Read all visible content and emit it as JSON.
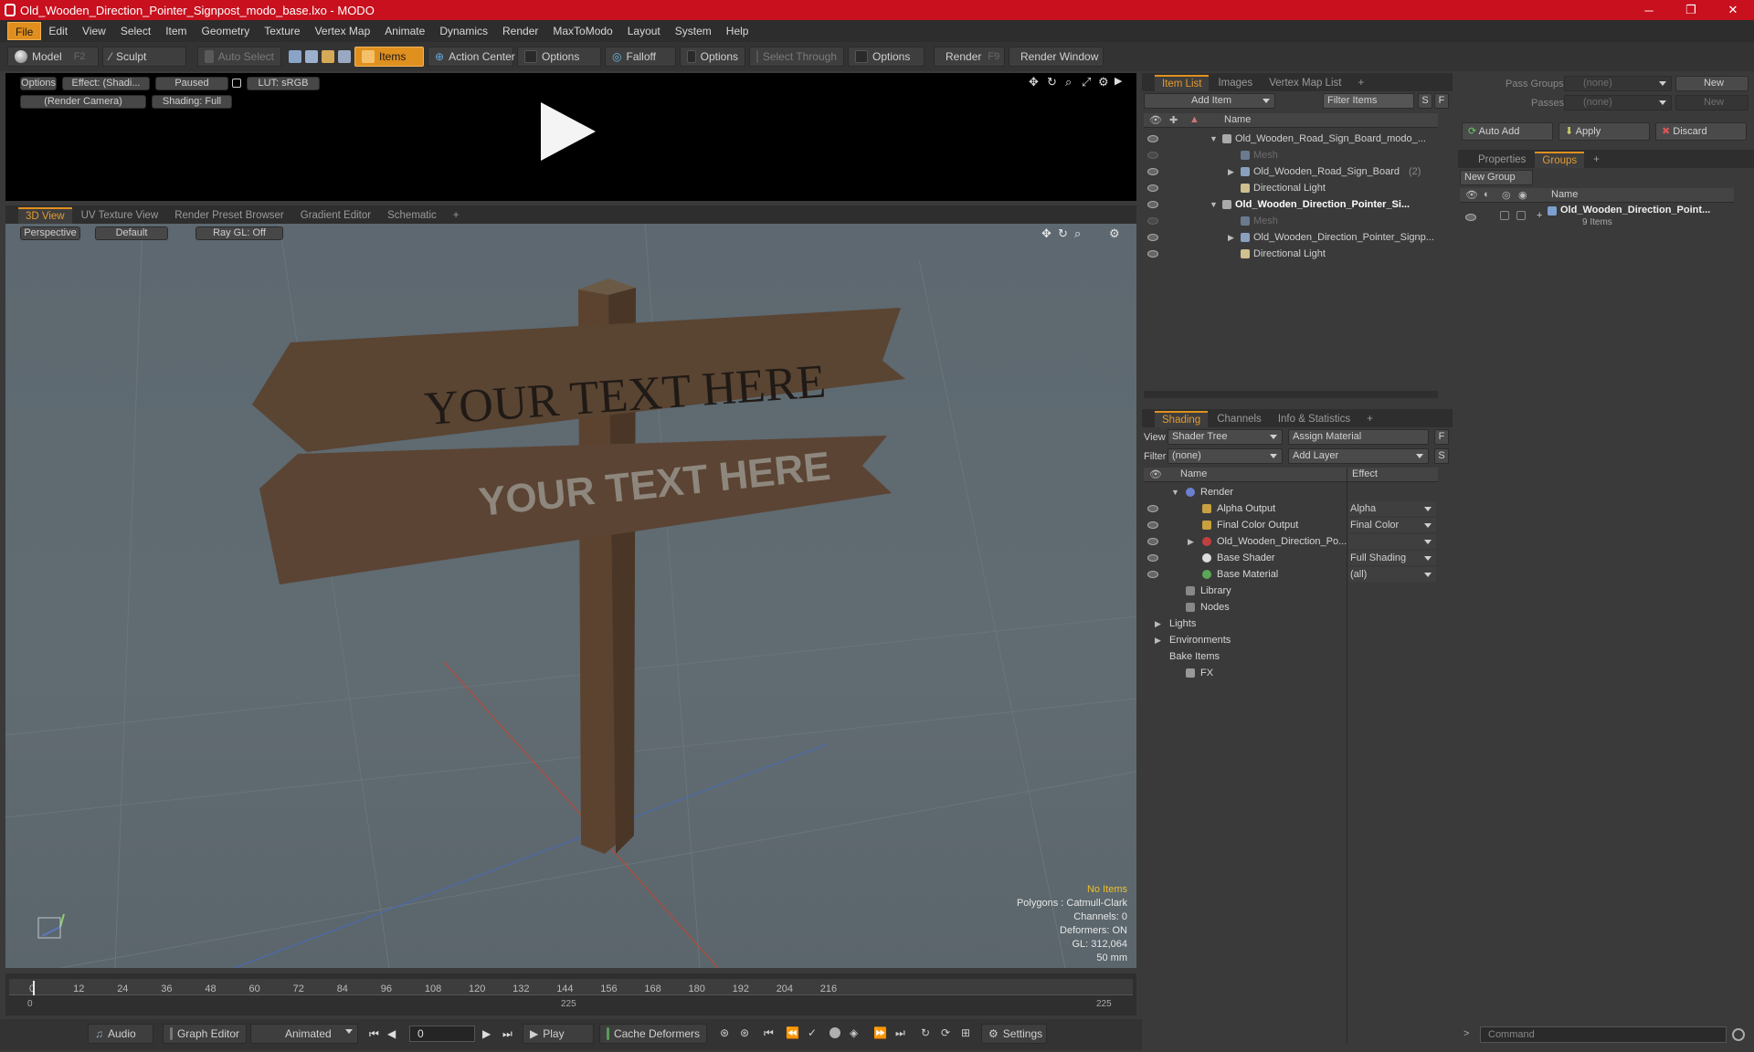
{
  "window": {
    "title": "Old_Wooden_Direction_Pointer_Signpost_modo_base.lxo - MODO",
    "minimize": "─",
    "maximize": "❐",
    "close": "✕"
  },
  "menu": [
    "File",
    "Edit",
    "View",
    "Select",
    "Item",
    "Geometry",
    "Texture",
    "Vertex Map",
    "Animate",
    "Dynamics",
    "Render",
    "MaxToModo",
    "Layout",
    "System",
    "Help"
  ],
  "toolbar": {
    "model": "Model",
    "model_key": "F2",
    "sculpt": "Sculpt",
    "auto_select": "Auto Select",
    "items": "Items",
    "action_center": "Action Center",
    "options1": "Options",
    "falloff": "Falloff",
    "options2": "Options",
    "select_through": "Select Through",
    "options3": "Options",
    "render": "Render",
    "render_key": "F9",
    "render_window": "Render Window"
  },
  "preview": {
    "options": "Options",
    "effect": "Effect: (Shadi...",
    "paused": "Paused",
    "lut": "LUT: sRGB",
    "camera": "(Render Camera)",
    "shading": "Shading: Full"
  },
  "viewport_tabs": [
    "3D View",
    "UV Texture View",
    "Render Preset Browser",
    "Gradient Editor",
    "Schematic",
    "+"
  ],
  "viewport": {
    "perspective": "Perspective",
    "default": "Default",
    "raygl": "Ray GL: Off",
    "sign_text_top": "YOUR TEXT HERE",
    "sign_text_bottom": "YOUR TEXT HERE",
    "info": {
      "no_items": "No Items",
      "polygons": "Polygons : Catmull-Clark",
      "channels": "Channels: 0",
      "deformers": "Deformers: ON",
      "gl": "GL: 312,064",
      "size": "50 mm"
    }
  },
  "timeline": {
    "ticks": [
      "0",
      "12",
      "24",
      "36",
      "48",
      "60",
      "72",
      "84",
      "96",
      "108",
      "120",
      "132",
      "144",
      "156",
      "168",
      "180",
      "192",
      "204",
      "216"
    ],
    "start": "0",
    "mid": "225",
    "end": "225"
  },
  "transport": {
    "audio": "Audio",
    "graph_editor": "Graph Editor",
    "animated": "Animated",
    "frame": "0",
    "play": "Play",
    "cache": "Cache Deformers",
    "settings": "Settings"
  },
  "item_list": {
    "tabs": [
      "Item List",
      "Images",
      "Vertex Map List",
      "+"
    ],
    "add_item": "Add Item",
    "filter": "Filter Items",
    "s": "S",
    "f": "F",
    "col_name": "Name",
    "rows": [
      {
        "label": "Old_Wooden_Road_Sign_Board_modo_...",
        "bold": false
      },
      {
        "label": "Mesh",
        "bold": false
      },
      {
        "label": "Old_Wooden_Road_Sign_Board",
        "suffix": "(2)",
        "bold": false
      },
      {
        "label": "Directional Light",
        "bold": false
      },
      {
        "label": "Old_Wooden_Direction_Pointer_Si...",
        "bold": true
      },
      {
        "label": "Mesh",
        "bold": false
      },
      {
        "label": "Old_Wooden_Direction_Pointer_Signp...",
        "bold": false
      },
      {
        "label": "Directional Light",
        "bold": false
      }
    ]
  },
  "shading": {
    "tabs": [
      "Shading",
      "Channels",
      "Info & Statistics",
      "+"
    ],
    "view_label": "View",
    "view_value": "Shader Tree",
    "assign": "Assign Material",
    "f": "F",
    "filter_label": "Filter",
    "filter_value": "(none)",
    "add_layer": "Add Layer",
    "s": "S",
    "col_name": "Name",
    "col_effect": "Effect",
    "rows": [
      {
        "label": "Render",
        "effect": ""
      },
      {
        "label": "Alpha Output",
        "effect": "Alpha"
      },
      {
        "label": "Final Color Output",
        "effect": "Final Color"
      },
      {
        "label": "Old_Wooden_Direction_Po...",
        "effect": ""
      },
      {
        "label": "Base Shader",
        "effect": "Full Shading"
      },
      {
        "label": "Base Material",
        "effect": "(all)"
      },
      {
        "label": "Library",
        "effect": ""
      },
      {
        "label": "Nodes",
        "effect": ""
      },
      {
        "label": "Lights",
        "effect": ""
      },
      {
        "label": "Environments",
        "effect": ""
      },
      {
        "label": "Bake Items",
        "effect": ""
      },
      {
        "label": "FX",
        "effect": ""
      }
    ]
  },
  "groups": {
    "pass_groups": "Pass Groups",
    "pass_value": "(none)",
    "new1": "New",
    "passes": "Passes",
    "passes_value": "(none)",
    "new2": "New",
    "auto_add": "Auto Add",
    "apply": "Apply",
    "discard": "Discard",
    "tabs": [
      "Properties",
      "Groups",
      "+"
    ],
    "new_group": "New Group",
    "col_name": "Name",
    "group_name": "Old_Wooden_Direction_Point...",
    "group_count": "9 Items"
  },
  "command": {
    "placeholder": "Command"
  }
}
